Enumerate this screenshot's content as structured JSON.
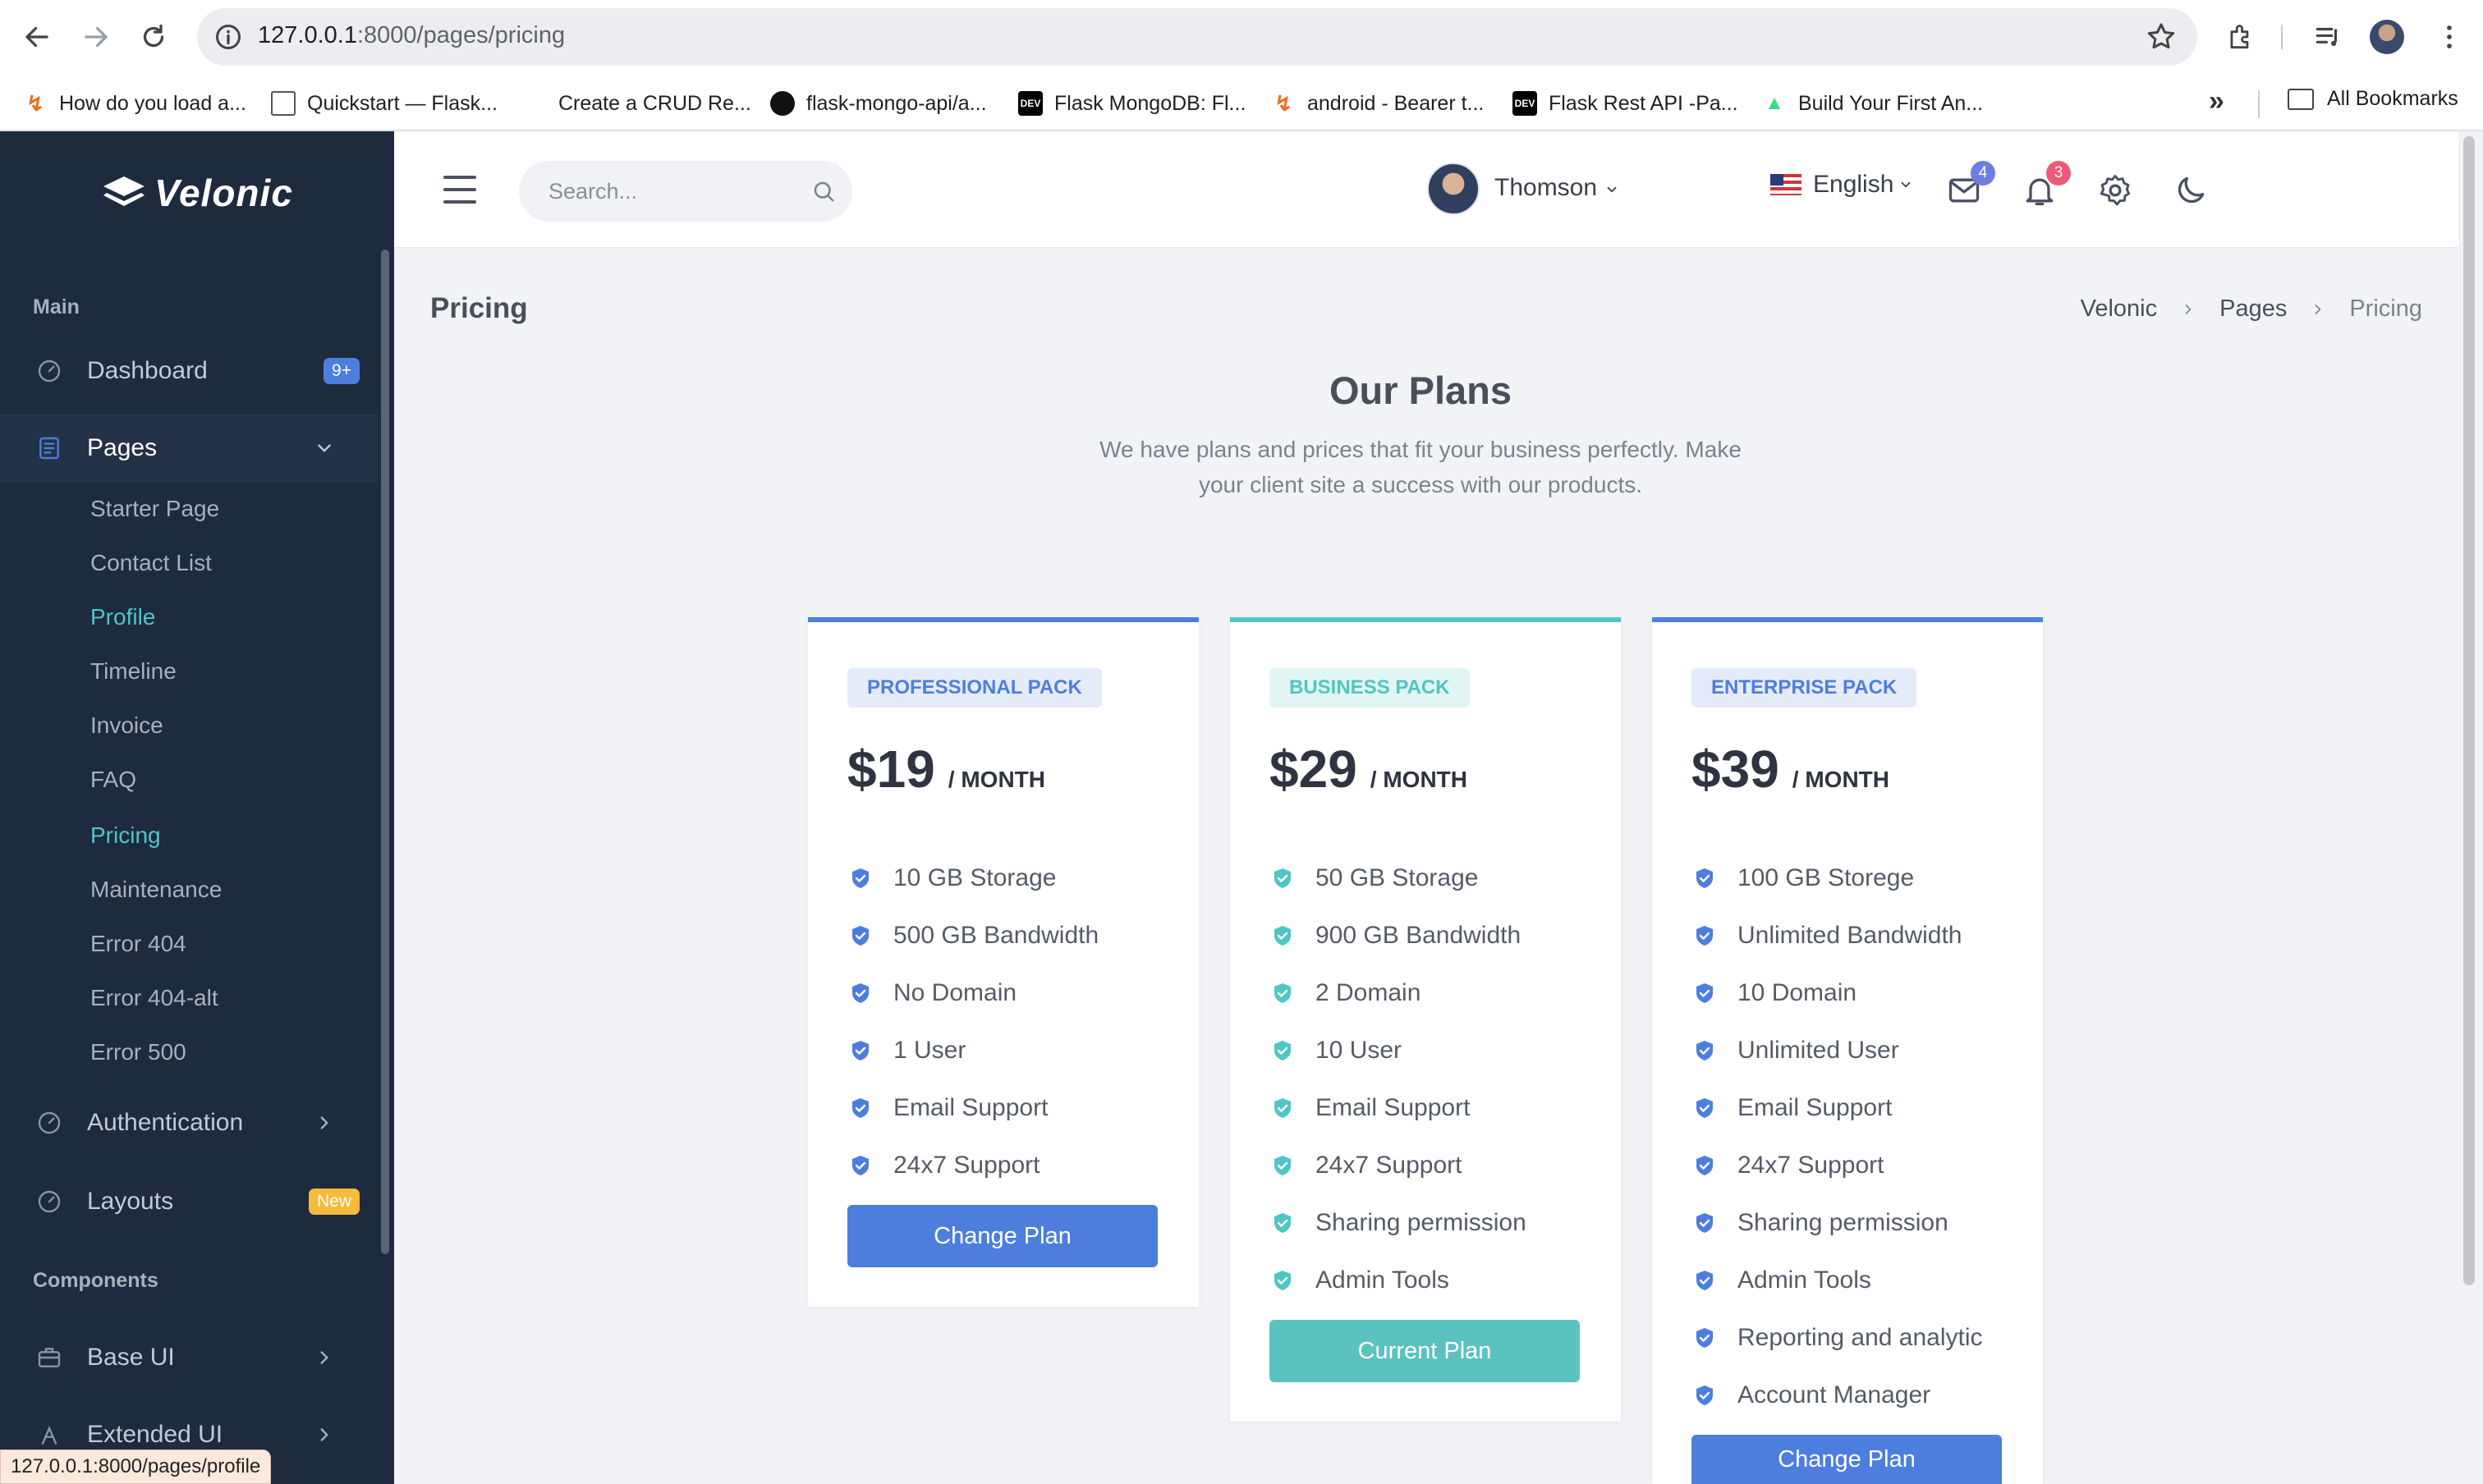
{
  "browser": {
    "url_host": "127.0.0.1",
    "url_path": ":8000/pages/pricing",
    "bookmarks": [
      {
        "label": "How do you load a...",
        "icon": "flask-favicon"
      },
      {
        "label": "Quickstart — Flask...",
        "icon": "doc-favicon"
      },
      {
        "label": "Create a CRUD Re...",
        "icon": "blank-favicon"
      },
      {
        "label": "flask-mongo-api/a...",
        "icon": "github-icon"
      },
      {
        "label": "Flask MongoDB: Fl...",
        "icon": "dev-favicon"
      },
      {
        "label": "android - Bearer t...",
        "icon": "flask-favicon"
      },
      {
        "label": "Flask Rest API -Pa...",
        "icon": "dev-favicon"
      },
      {
        "label": "Build Your First An...",
        "icon": "android-icon"
      }
    ],
    "more_glyph": "»",
    "all_bookmarks": "All Bookmarks",
    "status_url": "127.0.0.1:8000/pages/profile"
  },
  "sidebar": {
    "brand": "Velonic",
    "section_main": "Main",
    "dashboard": {
      "label": "Dashboard",
      "badge": "9+"
    },
    "pages": {
      "label": "Pages"
    },
    "sub_items": [
      "Starter Page",
      "Contact List",
      "Profile",
      "Timeline",
      "Invoice",
      "FAQ",
      "Pricing",
      "Maintenance",
      "Error 404",
      "Error 404-alt",
      "Error 500"
    ],
    "authentication": {
      "label": "Authentication"
    },
    "layouts": {
      "label": "Layouts",
      "badge": "New"
    },
    "section_components": "Components",
    "base_ui": {
      "label": "Base UI"
    },
    "extended_ui": {
      "label": "Extended UI"
    }
  },
  "header": {
    "search_placeholder": "Search...",
    "language": "English",
    "mail_count": "4",
    "notif_count": "3",
    "user_name": "Thomson"
  },
  "page": {
    "title": "Pricing",
    "breadcrumb": [
      "Velonic",
      "Pages",
      "Pricing"
    ]
  },
  "plans": {
    "title": "Our Plans",
    "subtitle": "We have plans and prices that fit your business perfectly. Make your client site a success with our products.",
    "items": [
      {
        "tag": "PROFESSIONAL PACK",
        "price": "$19",
        "period": "/ MONTH",
        "features": [
          "10 GB Storage",
          "500 GB Bandwidth",
          "No Domain",
          "1 User",
          "Email Support",
          "24x7 Support"
        ],
        "button": "Change Plan"
      },
      {
        "tag": "BUSINESS PACK",
        "price": "$29",
        "period": "/ MONTH",
        "features": [
          "50 GB Storage",
          "900 GB Bandwidth",
          "2 Domain",
          "10 User",
          "Email Support",
          "24x7 Support",
          "Sharing permission",
          "Admin Tools"
        ],
        "button": "Current Plan"
      },
      {
        "tag": "ENTERPRISE PACK",
        "price": "$39",
        "period": "/ MONTH",
        "features": [
          "100 GB Storege",
          "Unlimited Bandwidth",
          "10 Domain",
          "Unlimited User",
          "Email Support",
          "24x7 Support",
          "Sharing permission",
          "Admin Tools",
          "Reporting and analytic",
          "Account Manager"
        ],
        "button": "Change Plan"
      }
    ]
  },
  "colors": {
    "primary": "#4d7ede",
    "teal": "#4fc6c4",
    "sidebar_bg": "#1e2a3e"
  }
}
